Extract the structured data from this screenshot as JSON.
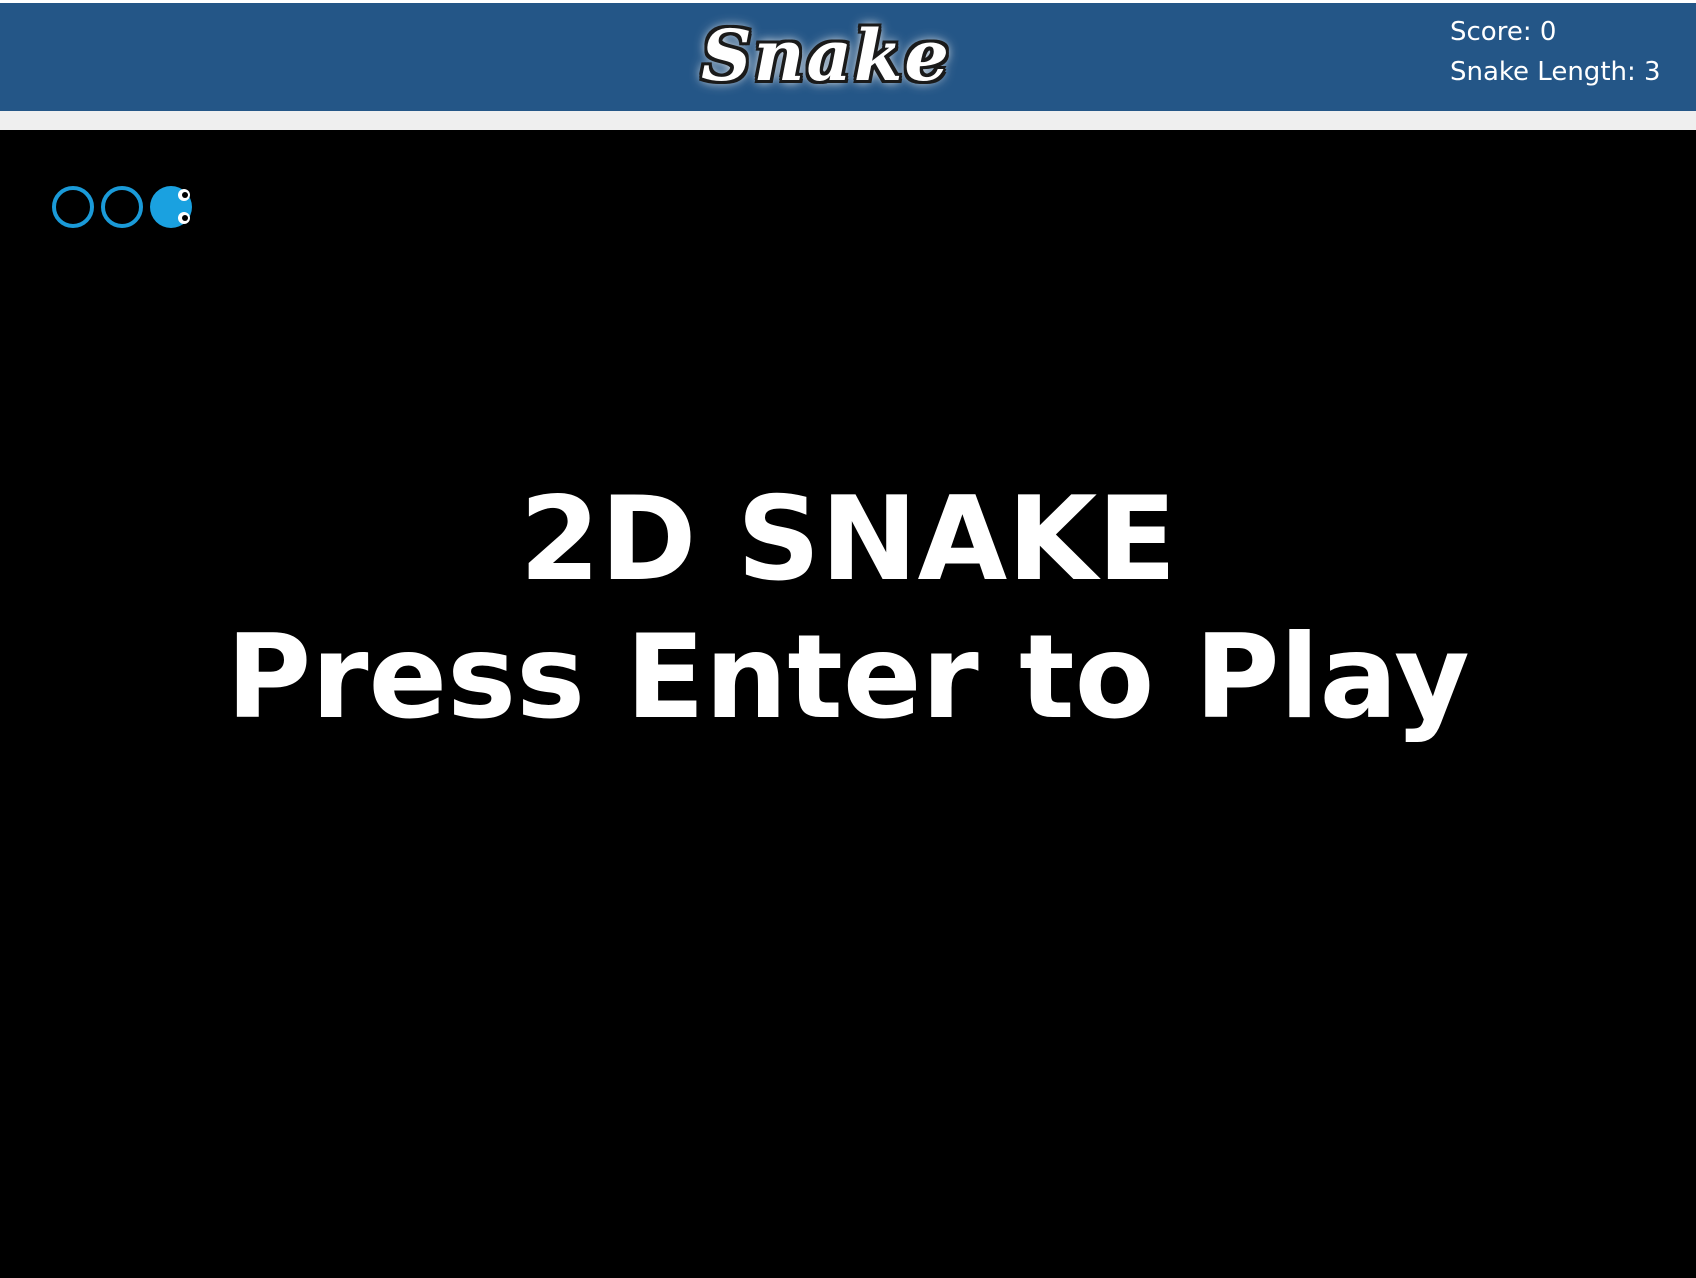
{
  "header": {
    "logo_text": "Snake",
    "score_text": "Score: 0",
    "length_text": "Snake Length: 3"
  },
  "game": {
    "title": "2D SNAKE",
    "prompt": "Press Enter to Play",
    "score": 0,
    "snake_length": 3
  },
  "colors": {
    "header_bg": "#245687",
    "game_bg": "#000000",
    "snake": "#1a9ad8",
    "text": "#ffffff"
  },
  "icons": {
    "snake_head": "snake-head-icon",
    "snake_body": "snake-body-segment"
  }
}
